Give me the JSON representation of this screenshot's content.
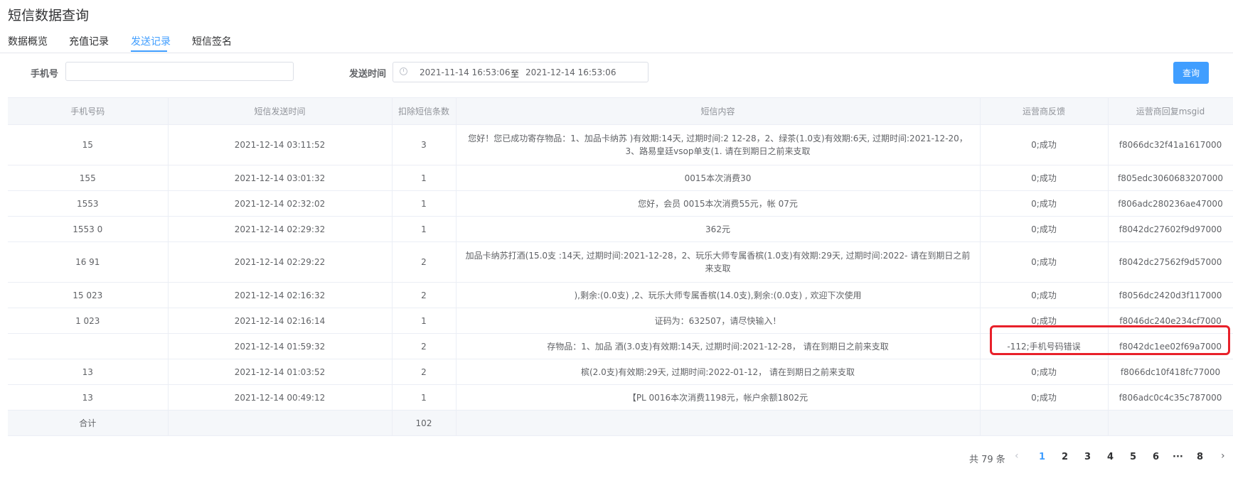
{
  "page_title": "短信数据查询",
  "tabs": [
    "数据概览",
    "充值记录",
    "发送记录",
    "短信签名"
  ],
  "active_tab": "发送记录",
  "filters": {
    "phone_label": "手机号",
    "phone_value": "",
    "time_label": "发送时间",
    "start_time": "2021-11-14 16:53:06",
    "range_separator": "至",
    "end_time": "2021-12-14 16:53:06",
    "query_button": "查询"
  },
  "table": {
    "columns": [
      "手机号码",
      "短信发送时间",
      "扣除短信条数",
      "短信内容",
      "运营商反馈",
      "运营商回复msgid"
    ],
    "rows": [
      {
        "phone": "15",
        "time": "2021-12-14 03:11:52",
        "count": "3",
        "content": "您好！您已成功寄存物品：1、加品卡纳苏 )有效期:14天, 过期时间:2 12-28，2、绿茶(1.0支)有效期:6天, 过期时间:2021-12-20，3、路易皇廷vsop单支(1. 请在到期日之前来支取",
        "feedback": "0;成功",
        "msgid": "f8066dc32f41a1617000",
        "tall": true
      },
      {
        "phone": "155",
        "time": "2021-12-14 03:01:32",
        "count": "1",
        "content": "0015本次消费30",
        "feedback": "0;成功",
        "msgid": "f805edc3060683207000",
        "tall": false
      },
      {
        "phone": "1553",
        "time": "2021-12-14 02:32:02",
        "count": "1",
        "content": "您好，会员 0015本次消费55元，帐 07元",
        "feedback": "0;成功",
        "msgid": "f806adc280236ae47000",
        "tall": false
      },
      {
        "phone": "1553 0",
        "time": "2021-12-14 02:29:32",
        "count": "1",
        "content": "362元",
        "feedback": "0;成功",
        "msgid": "f8042dc27602f9d97000",
        "tall": false
      },
      {
        "phone": "16 91",
        "time": "2021-12-14 02:29:22",
        "count": "2",
        "content": "加品卡纳苏打酒(15.0支 :14天, 过期时间:2021-12-28，2、玩乐大师专属香槟(1.0支)有效期:29天, 过期时间:2022- 请在到期日之前来支取",
        "feedback": "0;成功",
        "msgid": "f8042dc27562f9d57000",
        "tall": true
      },
      {
        "phone": "15 023",
        "time": "2021-12-14 02:16:32",
        "count": "2",
        "content": "),剩余:(0.0支) ,2、玩乐大师专属香槟(14.0支),剩余:(0.0支) , 欢迎下次使用",
        "feedback": "0;成功",
        "msgid": "f8056dc2420d3f117000",
        "tall": false
      },
      {
        "phone": "1 023",
        "time": "2021-12-14 02:16:14",
        "count": "1",
        "content": "证码为：632507，请尽快输入！",
        "feedback": "0;成功",
        "msgid": "f8046dc240e234cf7000",
        "tall": false
      },
      {
        "phone": "",
        "time": "2021-12-14 01:59:32",
        "count": "2",
        "content": "存物品：1、加品 酒(3.0支)有效期:14天, 过期时间:2021-12-28， 请在到期日之前来支取",
        "feedback": "-112;手机号码错误",
        "msgid": "f8042dc1ee02f69a7000",
        "tall": false
      },
      {
        "phone": "13",
        "time": "2021-12-14 01:03:52",
        "count": "2",
        "content": "槟(2.0支)有效期:29天, 过期时间:2022-01-12， 请在到期日之前来支取",
        "feedback": "0;成功",
        "msgid": "f8066dc10f418fc77000",
        "tall": false
      },
      {
        "phone": "13",
        "time": "2021-12-14 00:49:12",
        "count": "1",
        "content": "【PL 0016本次消费1198元，帐户余额1802元",
        "feedback": "0;成功",
        "msgid": "f806adc0c4c35c787000",
        "tall": false
      }
    ],
    "summary_label": "合计",
    "summary_count": "102"
  },
  "pagination": {
    "total_text": "共 79 条",
    "pages": [
      "1",
      "2",
      "3",
      "4",
      "5",
      "6",
      "···",
      "8"
    ],
    "active_page": "1",
    "prev_icon": "chevron-left-icon",
    "next_icon": "chevron-right-icon"
  },
  "colors": {
    "accent": "#409eff",
    "highlight_box": "#e8202a",
    "header_bg": "#f5f7fa"
  }
}
